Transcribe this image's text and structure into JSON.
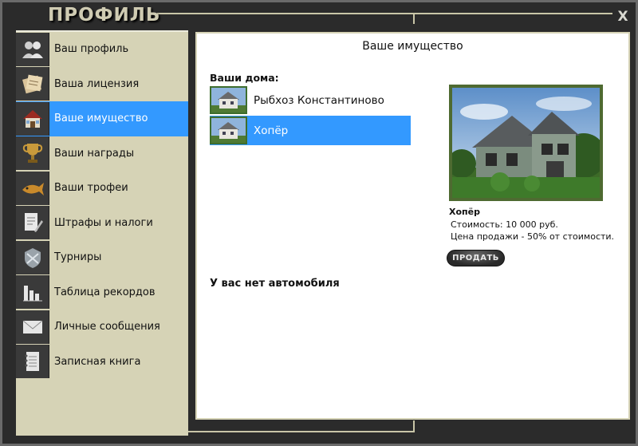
{
  "window": {
    "title": "ПРОФИЛЬ",
    "close_label": "X"
  },
  "sidebar": {
    "items": [
      {
        "label": "Ваш профиль",
        "icon": "people-icon",
        "active": false
      },
      {
        "label": "Ваша лицензия",
        "icon": "license-icon",
        "active": false
      },
      {
        "label": "Ваше имущество",
        "icon": "house-icon",
        "active": true
      },
      {
        "label": "Ваши награды",
        "icon": "trophy-icon",
        "active": false
      },
      {
        "label": "Ваши трофеи",
        "icon": "fish-trophy-icon",
        "active": false
      },
      {
        "label": "Штрафы и налоги",
        "icon": "document-pen-icon",
        "active": false
      },
      {
        "label": "Турниры",
        "icon": "tournament-emblem-icon",
        "active": false
      },
      {
        "label": "Таблица рекордов",
        "icon": "bar-chart-icon",
        "active": false
      },
      {
        "label": "Личные сообщения",
        "icon": "envelope-icon",
        "active": false
      },
      {
        "label": "Записная книга",
        "icon": "notebook-icon",
        "active": false
      }
    ]
  },
  "main": {
    "title": "Ваше имущество",
    "houses_label": "Ваши дома:",
    "houses": [
      {
        "name": "Рыбхоз Константиново",
        "active": false
      },
      {
        "name": "Хопёр",
        "active": true
      }
    ],
    "no_car_text": "У вас нет автомобиля",
    "detail": {
      "name": "Хопёр",
      "cost": "Стоимость: 10 000 руб.",
      "sale_price": "Цена продажи - 50% от стоимости."
    },
    "sell_button": "ПРОДАТЬ"
  },
  "colors": {
    "accent": "#3399ff",
    "sidebar_bg": "#d6d3b6",
    "frame_bg": "#2b2b2b"
  }
}
